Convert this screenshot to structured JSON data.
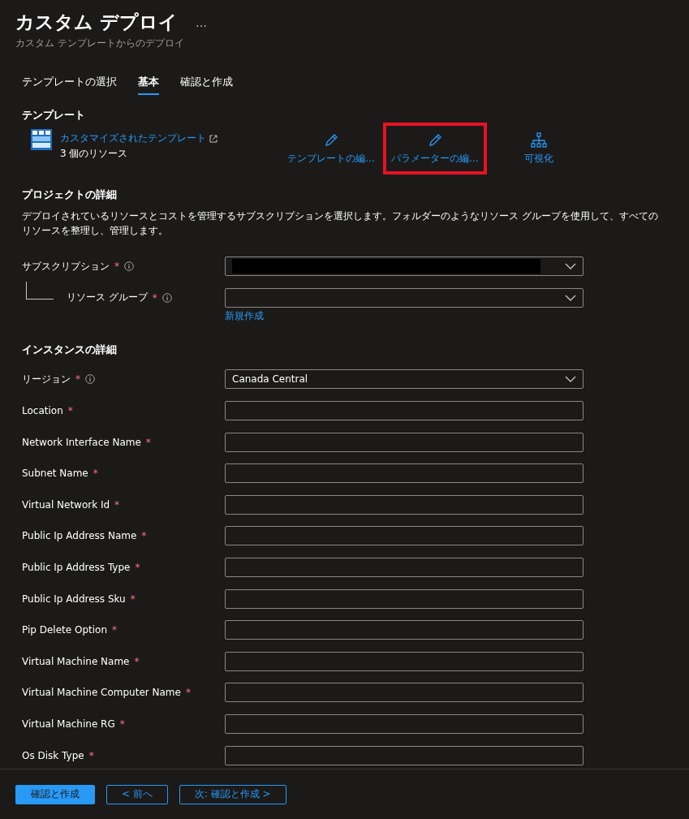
{
  "header": {
    "title": "カスタム デプロイ",
    "more": "…",
    "subtitle": "カスタム テンプレートからのデプロイ"
  },
  "tabs": [
    {
      "label": "テンプレートの選択",
      "selected": false
    },
    {
      "label": "基本",
      "selected": true
    },
    {
      "label": "確認と作成",
      "selected": false
    }
  ],
  "template": {
    "heading": "テンプレート",
    "name": "カスタマイズされたテンプレート",
    "resources": "3 個のリソース",
    "actions": [
      {
        "kind": "edit",
        "label": "テンプレートの編...",
        "highlighted": false
      },
      {
        "kind": "edit",
        "label": "パラメーターの編...",
        "highlighted": true
      },
      {
        "kind": "visualize",
        "label": "可視化",
        "highlighted": false
      }
    ]
  },
  "project": {
    "heading": "プロジェクトの詳細",
    "description": "デプロイされているリソースとコストを管理するサブスクリプションを選択します。フォルダーのようなリソース グループを使用して、すべてのリソースを整理し、管理します。",
    "subscription": {
      "label": "サブスクリプション",
      "required_mark": "*",
      "redacted": true
    },
    "resource_group": {
      "label": "リソース グループ",
      "required_mark": "*",
      "link": "新規作成"
    }
  },
  "instance": {
    "heading": "インスタンスの詳細",
    "fields": [
      {
        "kind": "dropdown",
        "label": "リージョン",
        "required_mark": "*",
        "info": true,
        "value": "Canada Central"
      },
      {
        "kind": "text",
        "label": "Location",
        "required_mark": "*",
        "info": false
      },
      {
        "kind": "text",
        "label": "Network Interface Name",
        "required_mark": "*",
        "info": false
      },
      {
        "kind": "text",
        "label": "Subnet Name",
        "required_mark": "*",
        "info": false
      },
      {
        "kind": "text",
        "label": "Virtual Network Id",
        "required_mark": "*",
        "info": false
      },
      {
        "kind": "text",
        "label": "Public Ip Address Name",
        "required_mark": "*",
        "info": false
      },
      {
        "kind": "text",
        "label": "Public Ip Address Type",
        "required_mark": "*",
        "info": false
      },
      {
        "kind": "text",
        "label": "Public Ip Address Sku",
        "required_mark": "*",
        "info": false
      },
      {
        "kind": "text",
        "label": "Pip Delete Option",
        "required_mark": "*",
        "info": false
      },
      {
        "kind": "text",
        "label": "Virtual Machine Name",
        "required_mark": "*",
        "info": false
      },
      {
        "kind": "text",
        "label": "Virtual Machine Computer Name",
        "required_mark": "*",
        "info": false
      },
      {
        "kind": "text",
        "label": "Virtual Machine RG",
        "required_mark": "*",
        "info": false
      },
      {
        "kind": "text",
        "label": "Os Disk Type",
        "required_mark": "*",
        "info": false
      }
    ]
  },
  "footer": {
    "buttons": [
      {
        "kind": "primary",
        "label": "確認と作成"
      },
      {
        "kind": "secondary",
        "label": "< 前へ"
      },
      {
        "kind": "secondary",
        "label": "次: 確認と作成 >"
      }
    ]
  }
}
